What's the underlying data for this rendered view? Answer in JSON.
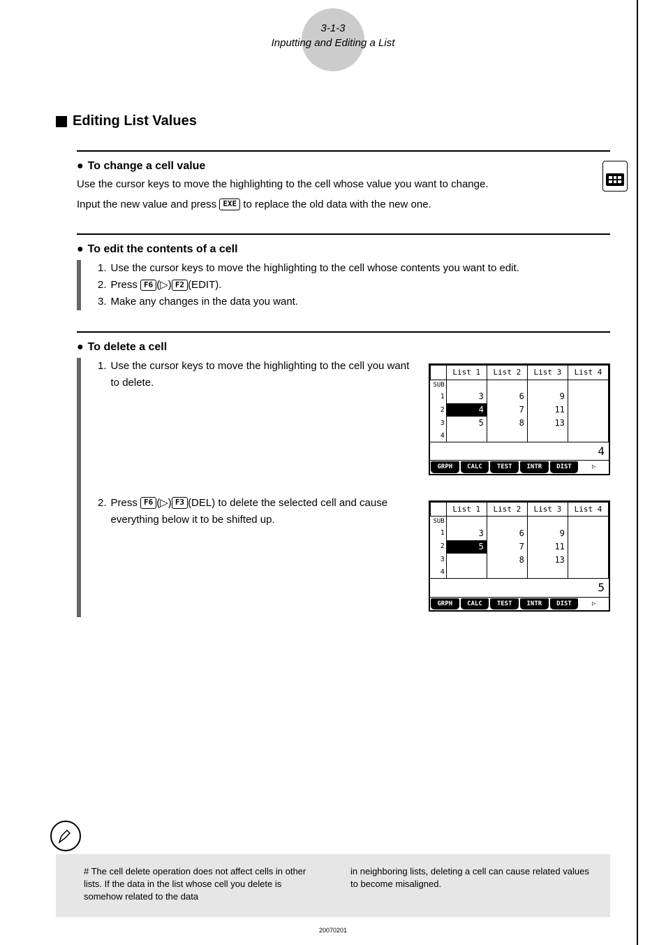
{
  "header": {
    "section_num": "3-1-3",
    "section_title": "Inputting and Editing a List"
  },
  "main_heading": "Editing List Values",
  "sub1": {
    "title": "To change a cell value",
    "body1": "Use the cursor keys to move the highlighting to the cell whose value you want to change.",
    "body2_pre": "Input the new value and press ",
    "body2_key": "EXE",
    "body2_post": " to replace the old data with the new one."
  },
  "sub2": {
    "title": "To edit the contents of a cell",
    "step1": "Use the cursor keys to move the highlighting to the cell whose contents you want to edit.",
    "step2_pre": "Press ",
    "step2_k1": "F6",
    "step2_p1": "(▷)",
    "step2_k2": "F2",
    "step2_p2": "(EDIT).",
    "step3": "Make any changes in the data you want."
  },
  "sub3": {
    "title": "To delete a cell",
    "step1": "Use the cursor keys to move the highlighting to the cell you want to delete.",
    "step2_pre": "Press ",
    "step2_k1": "F6",
    "step2_p1": "(▷)",
    "step2_k2": "F3",
    "step2_p2": "(DEL) to delete the selected cell and cause everything below it to be shifted up."
  },
  "note": {
    "col1": "# The cell delete operation does not affect cells in other lists. If the data in the list whose cell you delete is somehow related to the data",
    "col2": "in neighboring lists, deleting a cell can cause related values to become misaligned."
  },
  "page_code": "20070201",
  "screens": {
    "headers": [
      "List 1",
      "List 2",
      "List 3",
      "List 4"
    ],
    "sub_label": "SUB",
    "fkeys": [
      "GRPH",
      "CALC",
      "TEST",
      "INTR",
      "DIST",
      "▷"
    ],
    "s1": {
      "rows": [
        {
          "n": "1",
          "c": [
            "3",
            "6",
            "9",
            ""
          ]
        },
        {
          "n": "2",
          "c": [
            "4",
            "7",
            "11",
            ""
          ],
          "hl": 0
        },
        {
          "n": "3",
          "c": [
            "5",
            "8",
            "13",
            ""
          ]
        },
        {
          "n": "4",
          "c": [
            "",
            "",
            "",
            ""
          ]
        }
      ],
      "bottom": "4"
    },
    "s2": {
      "rows": [
        {
          "n": "1",
          "c": [
            "3",
            "6",
            "9",
            ""
          ]
        },
        {
          "n": "2",
          "c": [
            "5",
            "7",
            "11",
            ""
          ],
          "hl": 0
        },
        {
          "n": "3",
          "c": [
            "",
            "8",
            "13",
            ""
          ]
        },
        {
          "n": "4",
          "c": [
            "",
            "",
            "",
            ""
          ]
        }
      ],
      "bottom": "5"
    }
  }
}
